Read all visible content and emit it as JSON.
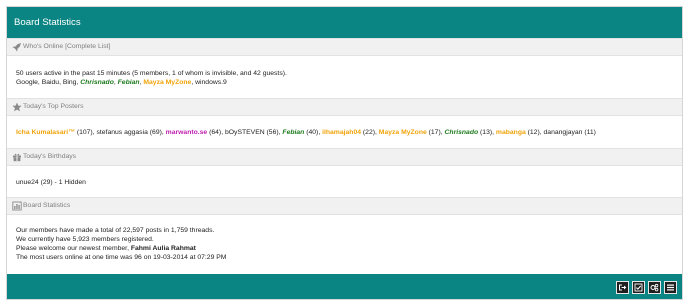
{
  "header": {
    "title": "Board Statistics"
  },
  "online": {
    "heading_prefix": "Who's Online ",
    "heading_link": "[Complete List]",
    "summary": "50 users active in the past 15 minutes (5 members, 1 of whom is invisible, and 42 guests).",
    "bots": "Google, Baidu, Bing, ",
    "members": [
      "Chrisnado",
      "Febian",
      "Mayza MyZone"
    ],
    "tail": ", windows.9"
  },
  "top_posters": {
    "heading": "Today's Top Posters",
    "entries": [
      {
        "name": "Icha Kumalasari™",
        "count": " (107)"
      },
      {
        "name": "stefanus aggasia",
        "count": " (69)"
      },
      {
        "name": "marwanto.se",
        "count": " (64)"
      },
      {
        "name": "bOySTEVEN",
        "count": " (56)"
      },
      {
        "name": "Febian",
        "count": " (40)"
      },
      {
        "name": "ilhamajah04",
        "count": " (22)"
      },
      {
        "name": "Mayza MyZone",
        "count": " (17)"
      },
      {
        "name": "Chrisnado",
        "count": " (13)"
      },
      {
        "name": "mabanga",
        "count": " (12)"
      },
      {
        "name": "danangjayan",
        "count": " (11)"
      }
    ]
  },
  "birthdays": {
    "heading": "Today's Birthdays",
    "text": "unue24 (29) - 1 Hidden"
  },
  "stats": {
    "heading": "Board Statistics",
    "line1": "Our members have made a total of 22,597 posts in 1,759 threads.",
    "line2": "We currently have 5,923 members registered.",
    "line3_prefix": "Please welcome our newest member, ",
    "newest_member": "Fahmi Aulia Rahmat",
    "line4": "The most users online at one time was 96 on 19-03-2014 at 07:29 PM"
  },
  "colors": {
    "header": "#0a8583",
    "section": "#f1f1f1"
  },
  "footer": {
    "icons": [
      "logout-icon",
      "mark-read-icon",
      "community-icon",
      "list-icon"
    ]
  }
}
